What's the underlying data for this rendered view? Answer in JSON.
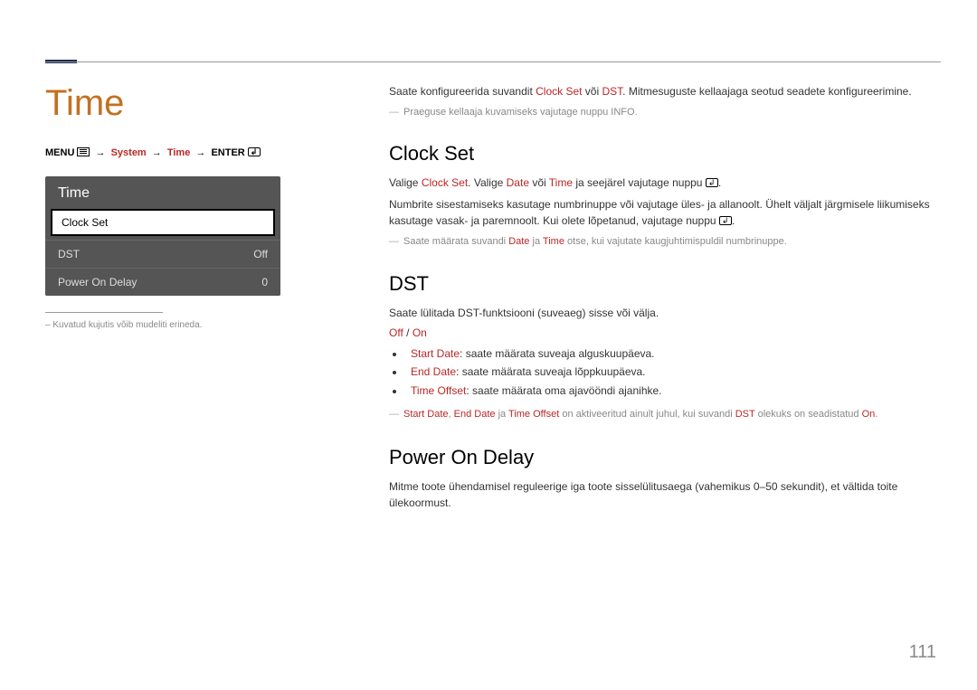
{
  "headings": {
    "main": "Time",
    "clock_set": "Clock Set",
    "dst": "DST",
    "power_on_delay": "Power On Delay"
  },
  "breadcrumb": {
    "menu": "MENU",
    "system": "System",
    "time": "Time",
    "enter": "ENTER"
  },
  "screenshot": {
    "title": "Time",
    "items": {
      "clock_set": {
        "label": "Clock Set",
        "value": ""
      },
      "dst": {
        "label": "DST",
        "value": "Off"
      },
      "pod": {
        "label": "Power On Delay",
        "value": "0"
      }
    }
  },
  "footnote_left": "Kuvatud kujutis võib mudeliti erineda.",
  "intro": {
    "p1_a": "Saate konfigureerida suvandit ",
    "p1_cs": "Clock Set",
    "p1_b": " või ",
    "p1_dst": "DST",
    "p1_c": ". Mitmesuguste kellaajaga seotud seadete konfigureerimine.",
    "note": "Praeguse kellaaja kuvamiseks vajutage nuppu INFO."
  },
  "clock_set": {
    "p1_a": "Valige ",
    "p1_cs": "Clock Set",
    "p1_b": ". Valige ",
    "p1_date": "Date",
    "p1_c": " või ",
    "p1_time": "Time",
    "p1_d": " ja seejärel vajutage nuppu ",
    "p1_e": ".",
    "p2": "Numbrite sisestamiseks kasutage numbrinuppe või vajutage üles- ja allanoolt. Ühelt väljalt järgmisele liikumiseks kasutage vasak- ja paremnoolt. Kui olete lõpetanud, vajutage nuppu ",
    "p2_e": ".",
    "note_a": "Saate määrata suvandi ",
    "note_date": "Date",
    "note_b": " ja ",
    "note_time": "Time",
    "note_c": " otse, kui vajutate kaugjuhtimispuldil numbrinuppe."
  },
  "dst": {
    "p1": "Saate lülitada DST-funktsiooni (suveaeg) sisse või välja.",
    "off": "Off",
    "on": "On",
    "bullets": {
      "start_label": "Start Date",
      "start_text": ": saate määrata suveaja alguskuupäeva.",
      "end_label": "End Date",
      "end_text": ": saate määrata suveaja lõppkuupäeva.",
      "offset_label": "Time Offset",
      "offset_text": ": saate määrata oma ajavööndi ajanihke."
    },
    "note_a": "",
    "note_start": "Start Date",
    "note_sep1": ", ",
    "note_end": "End Date",
    "note_sep2": " ja ",
    "note_offset": "Time Offset",
    "note_b": " on aktiveeritud ainult juhul, kui suvandi ",
    "note_dst": "DST",
    "note_c": " olekuks on seadistatud ",
    "note_on": "On",
    "note_d": "."
  },
  "pod": {
    "p1": "Mitme toote ühendamisel reguleerige iga toote sisselülitusaega (vahemikus 0–50 sekundit), et vältida toite ülekoormust."
  },
  "page_number": "111"
}
